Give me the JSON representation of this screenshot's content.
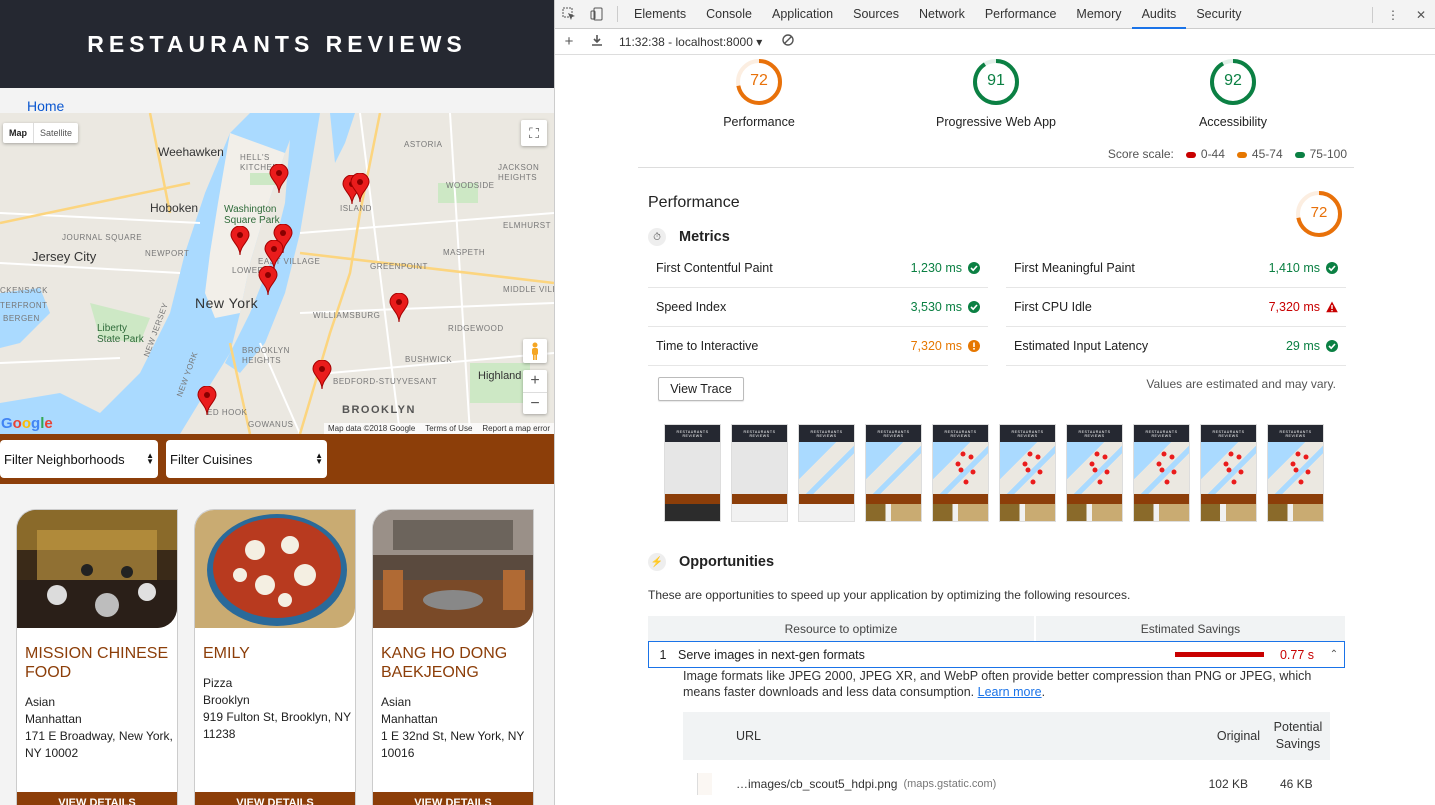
{
  "app": {
    "title": "RESTAURANTS REVIEWS",
    "breadcrumb": "Home",
    "map": {
      "map_tab": "Map",
      "satellite_tab": "Satellite",
      "google": "Google",
      "footer": [
        "Map data ©2018 Google",
        "Terms of Use",
        "Report a map error"
      ],
      "labels": {
        "weehawken": "Weehawken",
        "hoboken": "Hoboken",
        "jersey_city": "Jersey City",
        "washington_park": "Washington\nSquare Park",
        "new_york": "New York",
        "liberty_park": "Liberty\nState Park",
        "brooklyn": "BROOKLYN",
        "greenpoint": "GREENPOINT",
        "williamsburg": "WILLIAMSBURG",
        "bushwick": "BUSHWICK",
        "bedford": "BEDFORD-STUYVESANT",
        "astoria": "ASTORIA",
        "woodside": "WOODSIDE",
        "maspeth": "MASPETH",
        "ridgewood": "RIDGEWOOD",
        "jackson_heights": "JACKSON\nHEIGHTS",
        "elmhurst": "ELMHURST",
        "middle_village": "MIDDLE VILLAGE",
        "highland": "Highland P",
        "journal_square": "JOURNAL SQUARE",
        "newport": "NEWPORT",
        "lower": "LOWER",
        "east_village": "EAST VILLAGE",
        "red_hook": "ED HOOK",
        "gowanus": "GOWANUS",
        "brooklyn_heights": "BROOKLYN\nHEIGHTS",
        "island": "ISLAND",
        "ackensack": "CKENSACK",
        "bergen": "BERGEN",
        "terfront": "TERFRONT",
        "new_jersey": "NEW JERSEY",
        "new_york_bay": "NEW YORK",
        "hells": "HELL'S\nKITCHEN"
      }
    },
    "filters": {
      "neighborhoods": "Filter Neighborhoods",
      "cuisines": "Filter Cuisines"
    },
    "restaurants": [
      {
        "name": "MISSION CHINESE FOOD",
        "cuisine": "Asian",
        "neighborhood": "Manhattan",
        "address": "171 E Broadway, New York, NY 10002",
        "button": "VIEW DETAILS"
      },
      {
        "name": "EMILY",
        "cuisine": "Pizza",
        "neighborhood": "Brooklyn",
        "address": "919 Fulton St, Brooklyn, NY 11238",
        "button": "VIEW DETAILS"
      },
      {
        "name": "KANG HO DONG BAEKJEONG",
        "cuisine": "Asian",
        "neighborhood": "Manhattan",
        "address": "1 E 32nd St, New York, NY 10016",
        "button": "VIEW DETAILS"
      }
    ]
  },
  "devtools": {
    "tabs": [
      "Elements",
      "Console",
      "Application",
      "Sources",
      "Network",
      "Performance",
      "Memory",
      "Audits",
      "Security"
    ],
    "active_tab": "Audits",
    "report_time": "11:32:38 - localhost:8000",
    "gauges": [
      {
        "label": "Performance",
        "score": "72",
        "color": "#e8710a"
      },
      {
        "label": "Progressive Web App",
        "score": "91",
        "color": "#0b8043"
      },
      {
        "label": "Accessibility",
        "score": "92",
        "color": "#0b8043"
      }
    ],
    "score_scale": {
      "label": "Score scale:",
      "ranges": [
        {
          "range": "0-44",
          "color": "#c80000"
        },
        {
          "range": "45-74",
          "color": "#e67700"
        },
        {
          "range": "75-100",
          "color": "#0b8043"
        }
      ]
    },
    "performance": {
      "title": "Performance",
      "score": "72",
      "metrics_title": "Metrics",
      "metrics": [
        {
          "name": "First Contentful Paint",
          "value": "1,230 ms",
          "status": "good"
        },
        {
          "name": "First Meaningful Paint",
          "value": "1,410 ms",
          "status": "good"
        },
        {
          "name": "Speed Index",
          "value": "3,530 ms",
          "status": "good"
        },
        {
          "name": "First CPU Idle",
          "value": "7,320 ms",
          "status": "bad"
        },
        {
          "name": "Time to Interactive",
          "value": "7,320 ms",
          "status": "avg"
        },
        {
          "name": "Estimated Input Latency",
          "value": "29 ms",
          "status": "good"
        }
      ],
      "view_trace": "View Trace",
      "estimate_note": "Values are estimated and may vary.",
      "filmstrip_title": "RESTAURANTS\nREVIEWS",
      "opportunities_title": "Opportunities",
      "opportunities_desc": "These are opportunities to speed up your application by optimizing the following resources.",
      "col_resource": "Resource to optimize",
      "col_savings": "Estimated Savings",
      "opportunity": {
        "index": "1",
        "title": "Serve images in next-gen formats",
        "savings": "0.77 s",
        "savings_fraction": 1.0,
        "description": "Image formats like JPEG 2000, JPEG XR, and WebP often provide better compression than PNG or JPEG, which means faster downloads and less data consumption.",
        "learn_more": "Learn more",
        "table": {
          "col_url": "URL",
          "col_original": "Original",
          "col_potential": "Potential\nSavings",
          "row": {
            "url": "…images/cb_scout5_hdpi.png",
            "host": "(maps.gstatic.com)",
            "original": "102 KB",
            "savings": "46 KB"
          }
        }
      }
    }
  }
}
